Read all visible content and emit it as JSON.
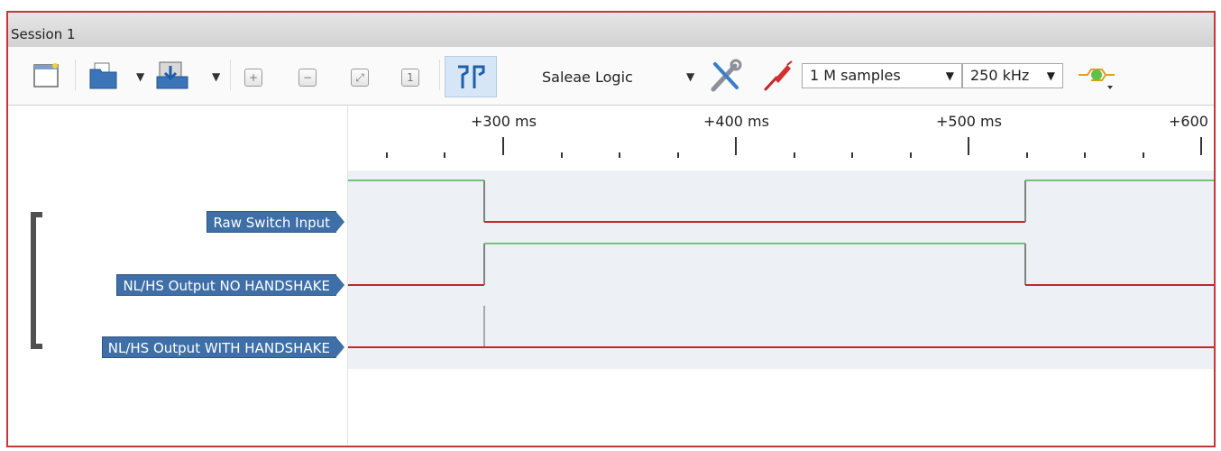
{
  "session": {
    "tab_label": "Session 1"
  },
  "toolbar": {
    "device": "Saleae Logic",
    "samples": "1 M samples",
    "rate": "250 kHz",
    "icons": [
      "new-session-icon",
      "open-file-icon",
      "save-export-icon",
      "zoom-in-icon",
      "zoom-out-icon",
      "zoom-fit-icon",
      "zoom-one-icon",
      "trigger-markers-icon",
      "settings-tools-icon",
      "analyzer-probe-icon",
      "simulation-icon"
    ]
  },
  "timeline": {
    "labels": [
      "+300 ms",
      "+400 ms",
      "+500 ms",
      "+600 ms"
    ]
  },
  "channels": [
    {
      "name": "Raw Switch Input"
    },
    {
      "name": "NL/HS Output NO HANDSHAKE"
    },
    {
      "name": "NL/HS Output WITH HANDSHAKE"
    }
  ],
  "colors": {
    "high": "#4caf50",
    "low": "#c0272d",
    "edge": "#808080",
    "tag": "#3e6fa7",
    "frame": "#c9363a"
  }
}
